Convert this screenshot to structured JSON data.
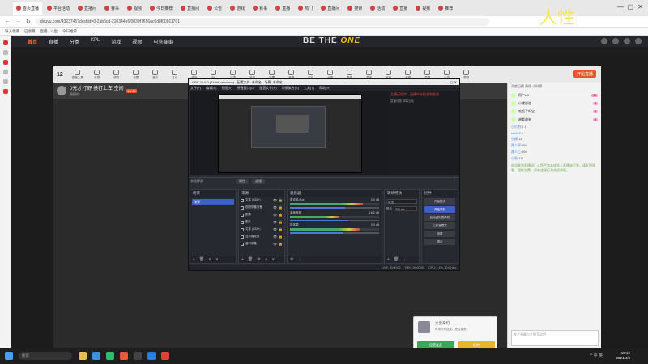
{
  "browser": {
    "tabs": [
      "首页直播",
      "平台活动",
      "直播间",
      "赛事",
      "视频",
      "今日推荐",
      "直播间",
      "公告",
      "游戏",
      "赛事",
      "直播",
      "热门",
      "直播间",
      "搜索",
      "活动",
      "直播",
      "视频",
      "推荐"
    ],
    "url": "douyu.com/4323745?dyshid=0-2ab6cd-210344e6f0030f7656ac6d8f00011701",
    "bookmarks": [
      "导入收藏",
      "已收藏",
      "直播 | 斗鱼",
      "今日推荐"
    ]
  },
  "site": {
    "nav": [
      "首页",
      "直播",
      "分类",
      "KPL",
      "游戏",
      "视频",
      "电竞赛事"
    ],
    "banner_a": "BE THE ",
    "banner_b": "ONE"
  },
  "stream": {
    "count": "12",
    "live_button": "开始直播",
    "toolbar": [
      "直播工具",
      "礼物",
      "弹幕",
      "设置",
      "音乐",
      "互动",
      "任务",
      "PK",
      "连麦",
      "抽奖",
      "投票",
      "竞猜",
      "红包",
      "分享",
      "数据",
      "更多",
      "贴纸",
      "美颜",
      "录屏",
      "公告",
      "帮助"
    ],
    "title": "0元才打野 摸打上车 空间",
    "subtitle": "直播中",
    "badge": "LV.48"
  },
  "chat": {
    "header": "贡献日榜  周榜  小时榜",
    "rank": [
      {
        "name": "用户A3",
        "lvl": "12"
      },
      {
        "name": "小猪崽崽",
        "lvl": "9"
      },
      {
        "name": "吃饭了吗宝",
        "lvl": "8"
      },
      {
        "name": "越看越有",
        "lvl": "6"
      }
    ],
    "lines": [
      {
        "user": "小灯泡:",
        "text": "1 1"
      },
      {
        "user": "kiz002:",
        "text": "1"
      },
      {
        "user": "空桶:",
        "text": "11"
      },
      {
        "user": "路人甲:",
        "text": "666"
      },
      {
        "user": "路人乙:",
        "text": "666"
      },
      {
        "user": "小秋:",
        "text": "111"
      }
    ],
    "notice": "欢迎来到直播间！斗鱼严禁未成年人直播或打赏，请文明观看、理性消费。如有违规行为欢迎举报。",
    "input_placeholder": "发个弹幕与主播互动吧"
  },
  "obs": {
    "title": "OBS 29.0.0 (64-bit, windows) - 配置文件: 未命名 - 场景: 未命名",
    "menu": [
      "文件(F)",
      "编辑(E)",
      "视图(V)",
      "停靠窗口(D)",
      "配置文件(P)",
      "场景集合(S)",
      "工具(T)",
      "帮助(H)"
    ],
    "side_highlight": "主播已同步：直播中未检测到推流",
    "side_sub": "直播设置  弹幕互动",
    "mid_label": "未选择源",
    "mid_buttons": [
      "属性",
      "滤镜"
    ],
    "docks": {
      "scenes": "场景",
      "sources": "来源",
      "mixer": "混音器",
      "transitions": "转场特效",
      "controls": "控件"
    },
    "scene_items": [
      "场景"
    ],
    "sources": [
      "文本 (GDI+)",
      "视频采集设备",
      "图像",
      "图片",
      "文本 (GDI+)",
      "显示器采集",
      "窗口采集"
    ],
    "mixer": [
      {
        "name": "麦克风/Aux",
        "db": "0.0 dB",
        "level": 0.82,
        "fader": 0.62
      },
      {
        "name": "桌面音频",
        "db": "-16.2 dB",
        "level": 0.55,
        "fader": 0.65
      },
      {
        "name": "媒体源",
        "db": "0.0 dB",
        "level": 0.78,
        "fader": 0.6
      }
    ],
    "transition": {
      "type": "淡出",
      "duration_label": "时长",
      "duration": "300 ms"
    },
    "controls": [
      "开始推流",
      "开始录制",
      "启动虚拟摄像机",
      "工作室模式",
      "设置",
      "退出"
    ],
    "status": [
      "LIVE: 00:00:00",
      "REC: 00:00:00",
      "CPU: 1.1%, 30.00 fps"
    ]
  },
  "toast": {
    "name": "大云朵幻",
    "message": "申请与你连麦，是否接受？",
    "accept": "接受连麦",
    "decline": "拒绝"
  },
  "taskbar": {
    "search": "搜索",
    "time": "19:12",
    "date": "2024/4/4",
    "tray": "^ 中 英"
  },
  "watermark": "人性",
  "colors": {
    "accent": "#ff6a2b",
    "obs_blue": "#3d60c6",
    "accept": "#3aa85a",
    "decline": "#e8b430"
  }
}
